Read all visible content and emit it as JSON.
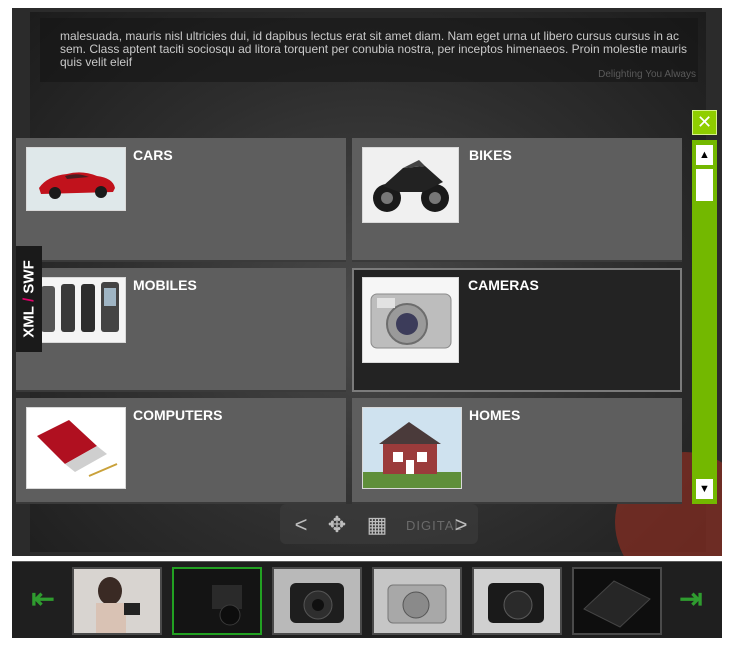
{
  "slide": {
    "caption": "malesuada, mauris nisl ultricies dui, id dapibus lectus erat sit amet diam. Nam eget urna ut libero cursus cursus in ac sem. Class aptent taciti sociosqu ad litora torquent per conubia nostra, per inceptos himenaeos. Proin molestie mauris quis velit eleif",
    "tagline": "Delighting You Always"
  },
  "photo_nav": {
    "label": "DIGITAL",
    "icons": [
      "chevron-left-icon",
      "move-icon",
      "grid-icon",
      "chevron-right-icon"
    ]
  },
  "categories": [
    {
      "label": "CARS",
      "icon": "car-icon"
    },
    {
      "label": "BIKES",
      "icon": "motorbike-icon"
    },
    {
      "label": "MOBILES",
      "icon": "mobile-phones-icon"
    },
    {
      "label": "CAMERAS",
      "icon": "camera-icon"
    },
    {
      "label": "COMPUTERS",
      "icon": "laptop-icon"
    },
    {
      "label": "HOMES",
      "icon": "house-icon"
    }
  ],
  "side_tab": {
    "left": "XML",
    "slash": "/",
    "right": "SWF"
  },
  "controls": {
    "close": "✕",
    "scroll_up": "▲",
    "scroll_down": "▼",
    "film_prev": "⇤",
    "film_next": "⇥"
  },
  "colors": {
    "accent_green": "#73b800",
    "filmstrip_arrow": "#2f9c2f",
    "slash_pink": "#e0006a"
  },
  "filmstrip": {
    "thumbnails": [
      "woman-with-camera",
      "camera-closeup",
      "dslr-camera",
      "silver-compact-camera",
      "black-dslr",
      "camera-dark"
    ],
    "selected_index": 1
  }
}
